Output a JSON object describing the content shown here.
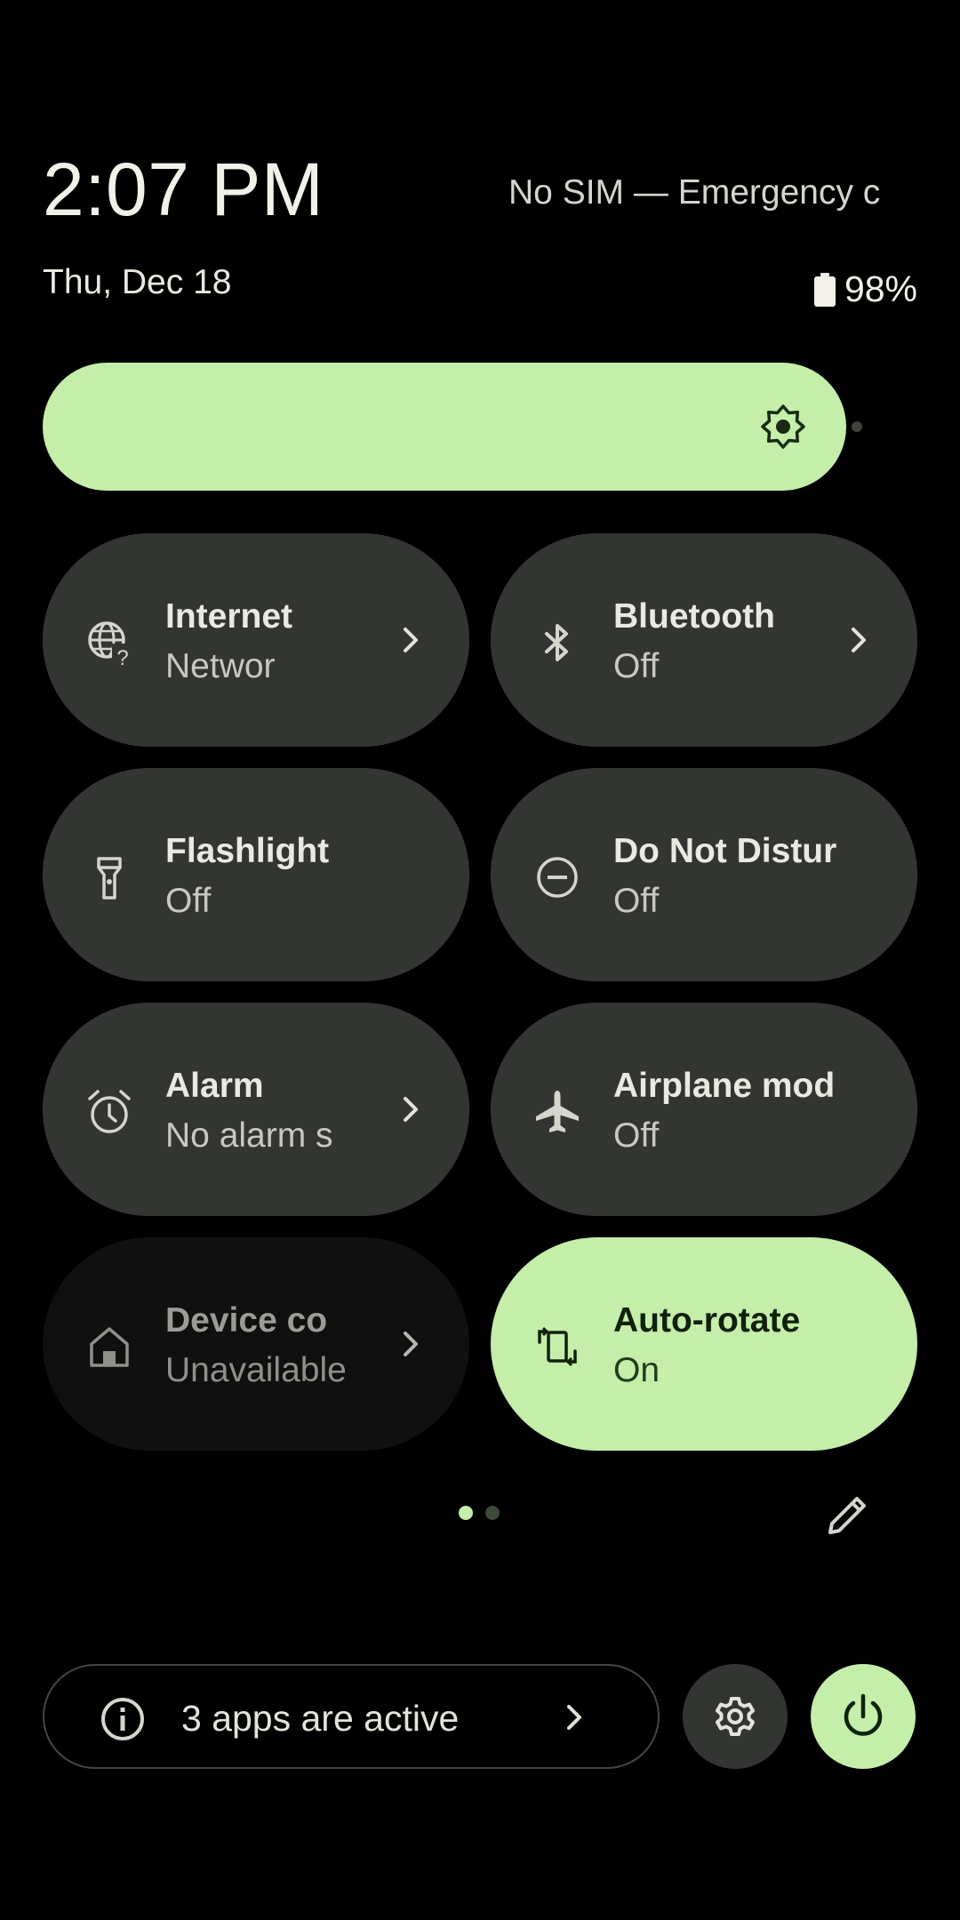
{
  "header": {
    "clock": "2:07 PM",
    "carrier": "No SIM — Emergency c",
    "date": "Thu, Dec 18",
    "battery_level": "98%"
  },
  "brightness": {
    "level_percent": 98,
    "icon": "brightness-icon"
  },
  "tiles": [
    {
      "title": "Internet",
      "subtitle": "Networ",
      "icon": "internet-unknown-icon",
      "state": "off",
      "has_chevron": true
    },
    {
      "title": "Bluetooth",
      "subtitle": "Off",
      "icon": "bluetooth-icon",
      "state": "off",
      "has_chevron": true
    },
    {
      "title": "Flashlight",
      "subtitle": "Off",
      "icon": "flashlight-icon",
      "state": "off",
      "has_chevron": false
    },
    {
      "title": "Do Not Distur",
      "subtitle": "Off",
      "icon": "do-not-disturb-icon",
      "state": "off",
      "has_chevron": false
    },
    {
      "title": "Alarm",
      "subtitle": "No alarm s",
      "icon": "alarm-icon",
      "state": "off",
      "has_chevron": true
    },
    {
      "title": "Airplane mod",
      "subtitle": "Off",
      "icon": "airplane-icon",
      "state": "off",
      "has_chevron": false
    },
    {
      "title": "Device co",
      "subtitle": "Unavailable",
      "icon": "home-icon",
      "state": "unavailable",
      "has_chevron": true
    },
    {
      "title": "Auto-rotate",
      "subtitle": "On",
      "icon": "auto-rotate-icon",
      "state": "on",
      "has_chevron": false
    }
  ],
  "pager": {
    "pages": 2,
    "current": 1
  },
  "footer": {
    "active_apps_label": "3 apps are active"
  },
  "colors": {
    "accent": "#c4eeaa",
    "tile": "#333532",
    "tile_disabled": "#0f100f",
    "background": "#000000"
  }
}
